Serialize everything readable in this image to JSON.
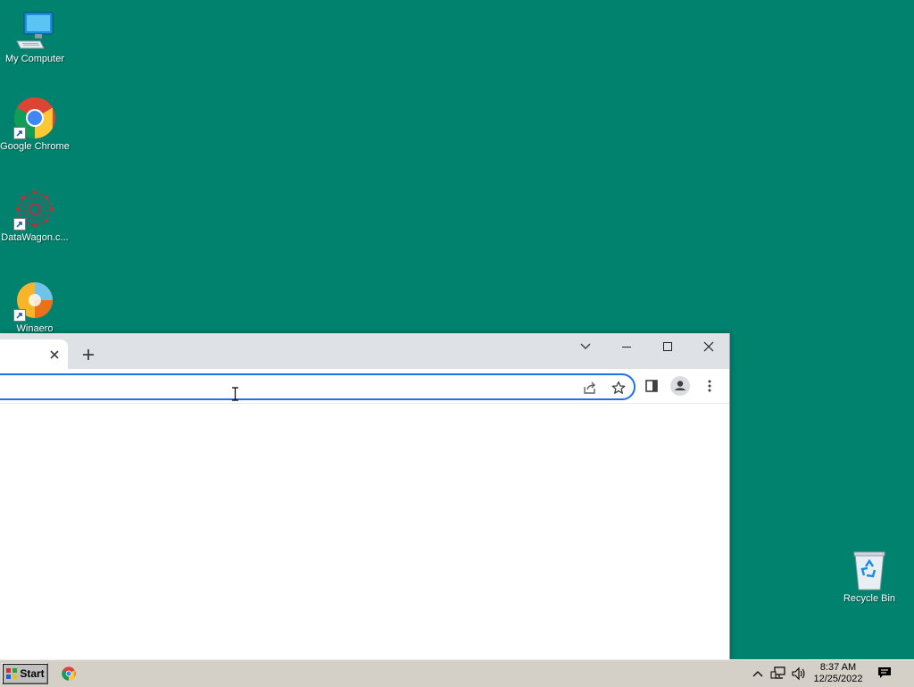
{
  "desktop": {
    "icons": [
      {
        "label": "My Computer"
      },
      {
        "label": "Google Chrome"
      },
      {
        "label": "DataWagon.c..."
      },
      {
        "label": "Winaero"
      },
      {
        "label": "Recycle Bin"
      }
    ]
  },
  "browser": {
    "tab": {
      "title": ""
    },
    "address": {
      "value": "",
      "placeholder": ""
    },
    "colors": {
      "titlebar": "#dee1e6",
      "focus_ring": "#1a73e8"
    }
  },
  "taskbar": {
    "start_label": "Start",
    "clock": {
      "time": "8:37 AM",
      "date": "12/25/2022"
    }
  },
  "colors": {
    "desktop": "#00826f",
    "taskbar": "#d4d0c8"
  }
}
